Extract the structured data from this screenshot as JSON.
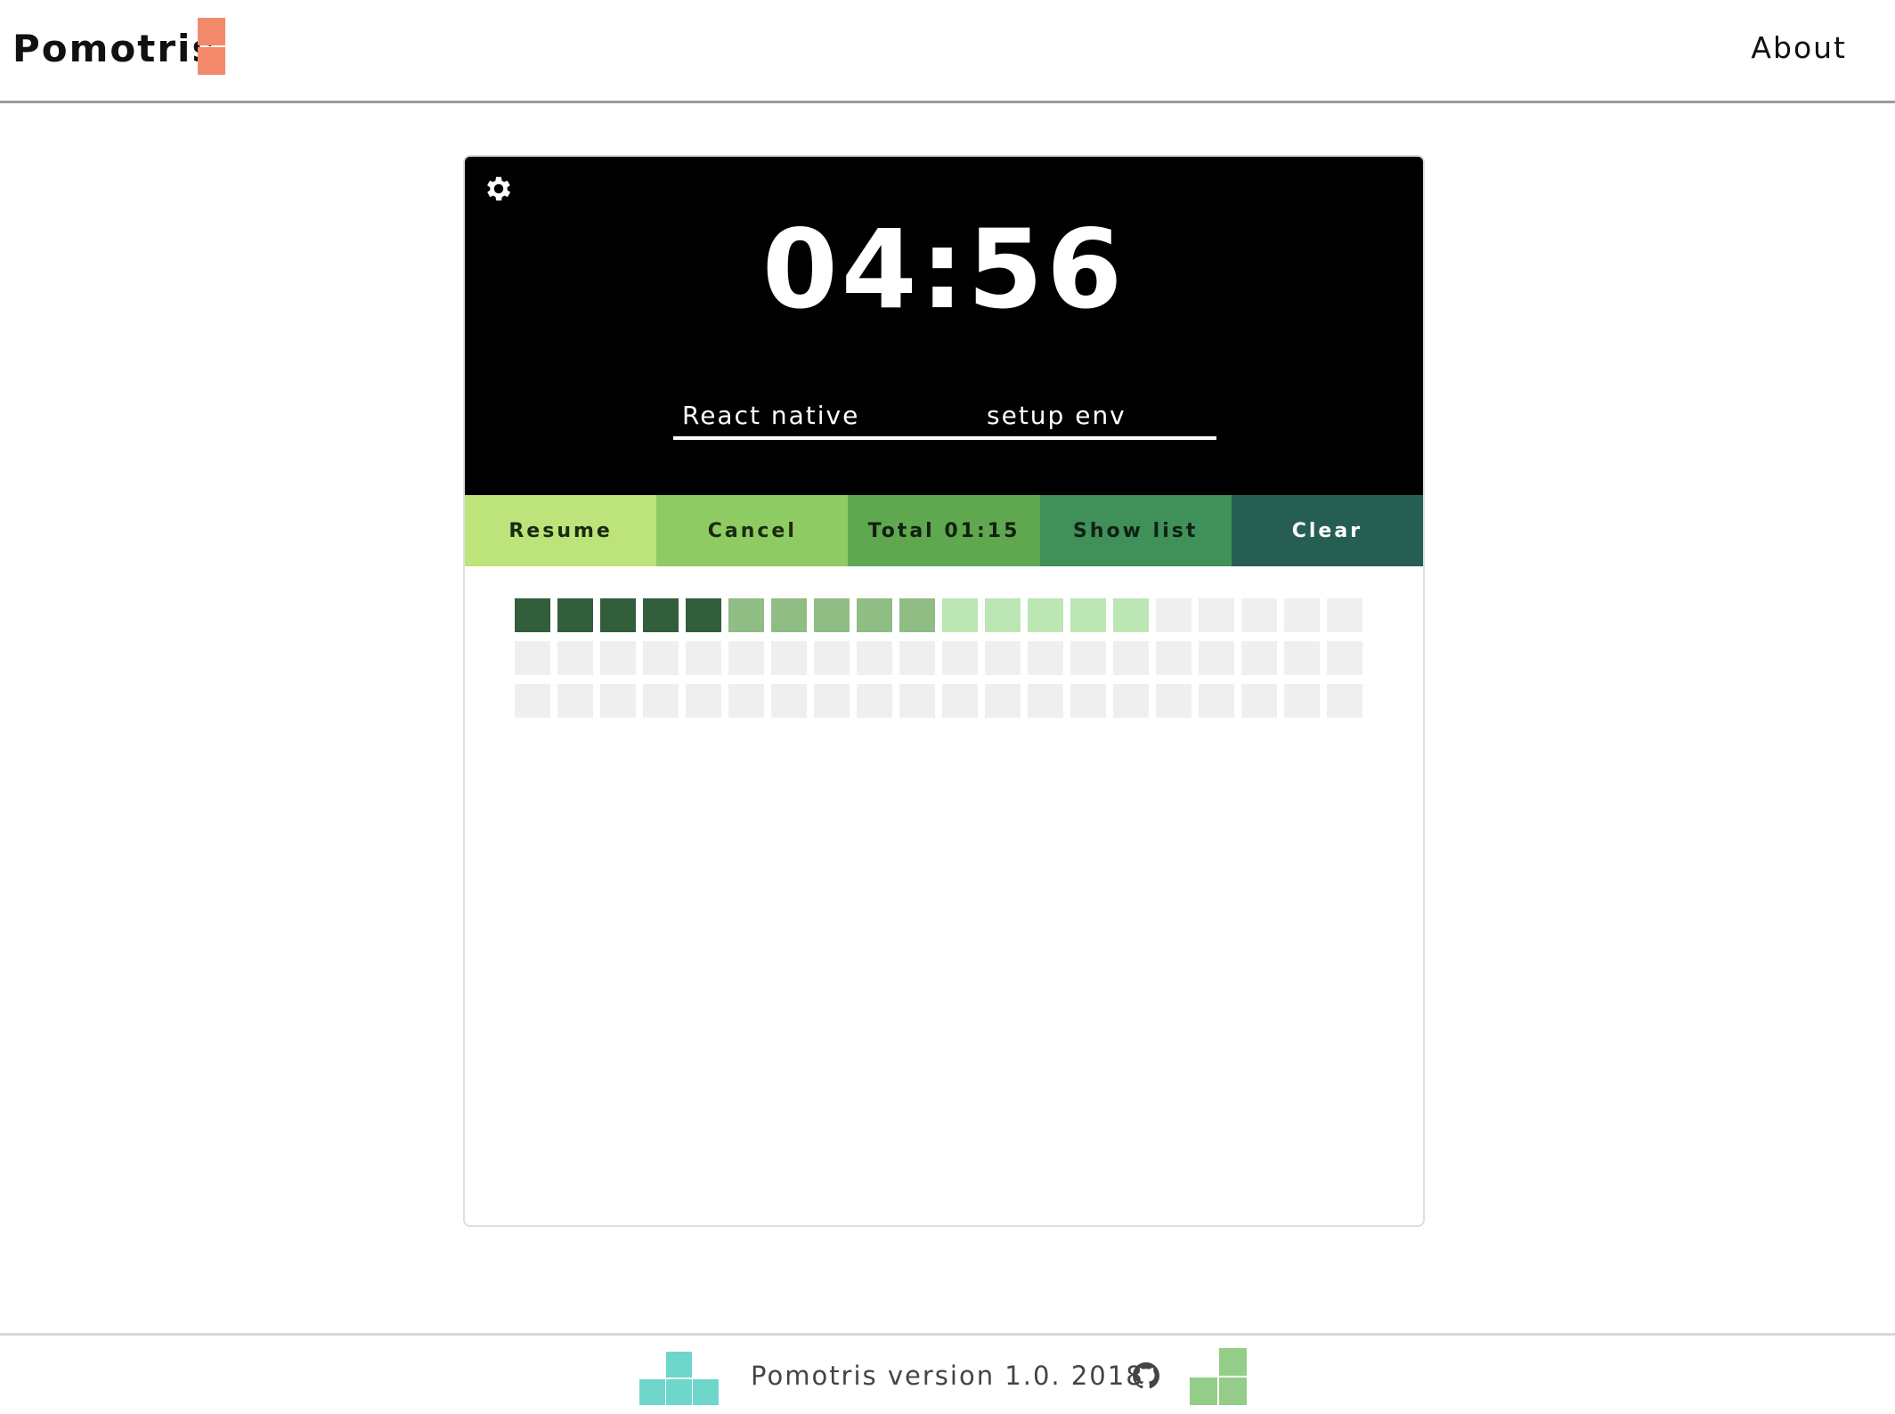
{
  "header": {
    "brand": "Pomotris",
    "brand_color": "#f3896b",
    "about_label": "About"
  },
  "timer": {
    "time": "04:56",
    "task_name": "React native",
    "task_description": "setup env",
    "settings_icon": "gear-icon"
  },
  "actions": [
    {
      "label": "Resume",
      "color": "#bce47a"
    },
    {
      "label": "Cancel",
      "color": "#8ecb62"
    },
    {
      "label": "Total 01:15",
      "color": "#5fa84f"
    },
    {
      "label": "Show list",
      "color": "#3f9159"
    },
    {
      "label": "Clear",
      "color": "#275e53"
    }
  ],
  "grid": {
    "columns": 20,
    "rows": 3,
    "colors": {
      "dark": "#335e3c",
      "mid": "#8fbd84",
      "light": "#bce6b4",
      "empty": "#efefef"
    },
    "filled": [
      {
        "shade": "dark",
        "count": 5
      },
      {
        "shade": "mid",
        "count": 5
      },
      {
        "shade": "light",
        "count": 5
      }
    ]
  },
  "footer": {
    "text": "Pomotris version 1.0. 2018",
    "github_icon": "github-icon"
  }
}
